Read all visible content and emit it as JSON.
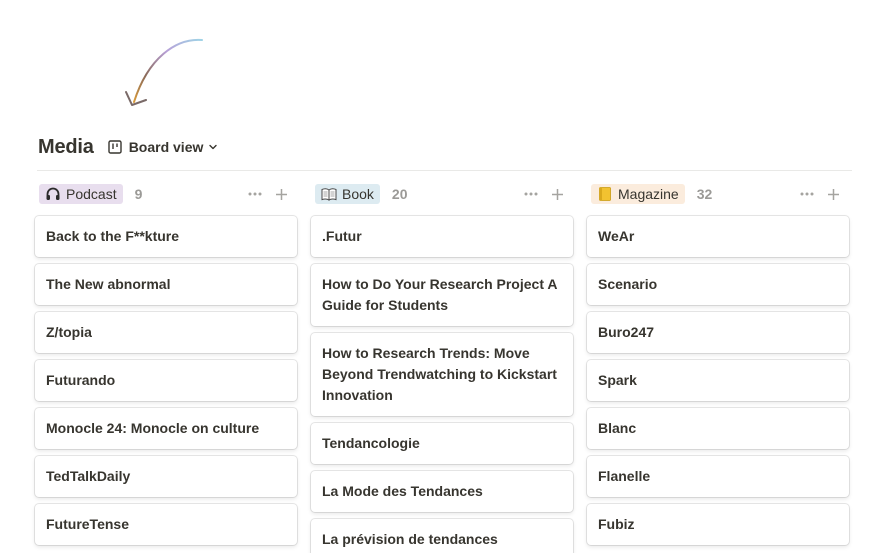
{
  "database": {
    "title": "Media",
    "view_label": "Board view"
  },
  "icons": {
    "board_view": "board-view-icon",
    "chevron": "chevron-down-icon",
    "more": "more-horizontal-icon",
    "add": "plus-icon"
  },
  "columns": [
    {
      "label": "Podcast",
      "icon": "headphones-icon",
      "count": "9",
      "tag_color": "#e8deee",
      "cards": [
        "Back to the F**kture",
        "The New abnormal",
        "Z/topia",
        "Futurando",
        "Monocle 24: Monocle on culture",
        "TedTalkDaily",
        "FutureTense"
      ]
    },
    {
      "label": "Book",
      "icon": "open-book-icon",
      "count": "20",
      "tag_color": "#ddebf1",
      "cards": [
        ".Futur",
        "How to Do Your Research Project A Guide for Students",
        "How to Research Trends: Move Beyond Trendwatching to Kickstart Innovation",
        "Tendancologie",
        "La Mode des Tendances",
        "La prévision de tendances"
      ]
    },
    {
      "label": "Magazine",
      "icon": "notebook-icon",
      "count": "32",
      "tag_color": "#fbecdd",
      "cards": [
        "WeAr",
        "Scenario",
        "Buro247",
        "Spark",
        "Blanc",
        "Flanelle",
        "Fubiz"
      ]
    }
  ]
}
